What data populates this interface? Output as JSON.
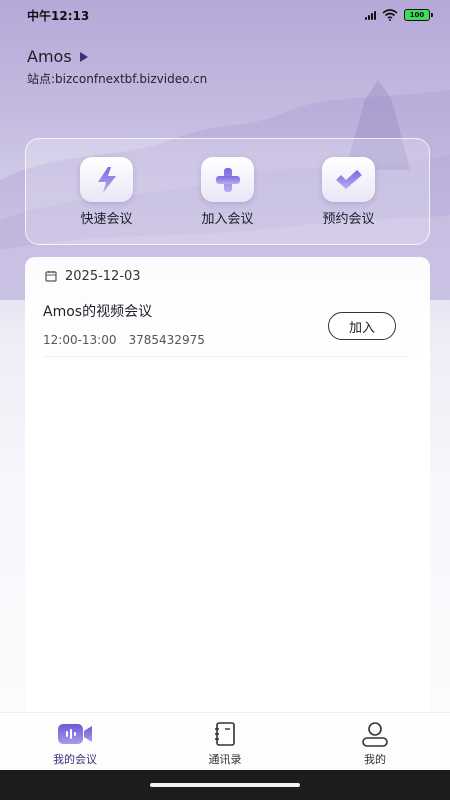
{
  "status": {
    "time": "中午12:13",
    "battery": "100"
  },
  "user": {
    "name": "Amos",
    "site": "站点:bizconfnextbf.bizvideo.cn"
  },
  "actions": [
    {
      "label": "快速会议",
      "icon": "lightning-icon"
    },
    {
      "label": "加入会议",
      "icon": "plus-icon"
    },
    {
      "label": "预约会议",
      "icon": "check-icon"
    }
  ],
  "meetings_card": {
    "date": "2025-12-03",
    "meeting": {
      "title": "Amos的视频会议",
      "time": "12:00-13:00",
      "id": "3785432975",
      "join_label": "加入"
    }
  },
  "tabs": [
    {
      "label": "我的会议",
      "active": true,
      "icon": "video-camera-icon"
    },
    {
      "label": "通讯录",
      "active": false,
      "icon": "contacts-book-icon"
    },
    {
      "label": "我的",
      "active": false,
      "icon": "person-icon"
    }
  ],
  "colors": {
    "accent": "#6b5bd2",
    "background_top": "#b5a9d8",
    "background_bottom": "#fbfbfd"
  }
}
